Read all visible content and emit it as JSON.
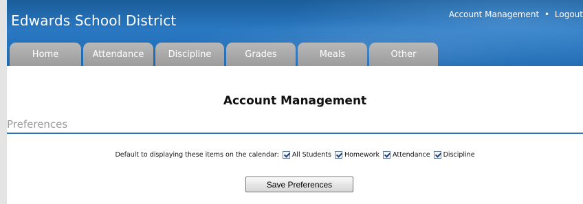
{
  "header": {
    "title": "Edwards School District",
    "account_link": "Account Management",
    "separator": "•",
    "logout_link": "Logout"
  },
  "tabs": [
    {
      "label": "Home"
    },
    {
      "label": "Attendance"
    },
    {
      "label": "Discipline"
    },
    {
      "label": "Grades"
    },
    {
      "label": "Meals"
    },
    {
      "label": "Other"
    }
  ],
  "main": {
    "title": "Account Management",
    "section_label": "Preferences",
    "calendar_prompt": "Default to displaying these items on the calendar:",
    "options": [
      {
        "label": "All Students",
        "checked": true
      },
      {
        "label": "Homework",
        "checked": true
      },
      {
        "label": "Attendance",
        "checked": true
      },
      {
        "label": "Discipline",
        "checked": true
      }
    ],
    "save_label": "Save Preferences"
  },
  "colors": {
    "header_blue": "#2a78c2",
    "tab_gray": "#a8a8a8",
    "section_line": "#2b74b8"
  }
}
